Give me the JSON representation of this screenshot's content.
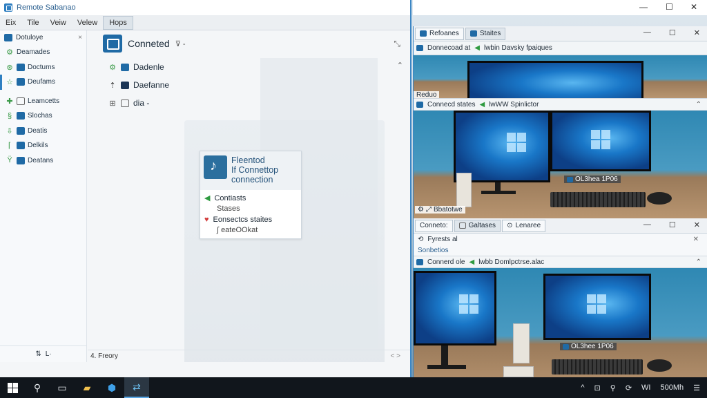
{
  "left_window": {
    "title": "Remote Sabanao",
    "menu": [
      "Eix",
      "Tile",
      "Veiw",
      "Velew",
      "Hops"
    ],
    "sidebar": {
      "header": "Dotuloye",
      "close": "×",
      "items": [
        {
          "icon": "gear-icon",
          "label": "Deamades"
        },
        {
          "icon": "network-icon",
          "label": "Doctums"
        },
        {
          "icon": "star-icon",
          "label": "Deufams"
        },
        {
          "icon": "arrow-icon",
          "label": "Leamcetts"
        },
        {
          "icon": "connector-icon",
          "label": "Slochas"
        },
        {
          "icon": "pin-icon",
          "label": "Deatis"
        },
        {
          "icon": "brace-icon",
          "label": "Delkils"
        },
        {
          "icon": "branch-icon",
          "label": "Deatans"
        }
      ],
      "footer_icon": "⇅",
      "footer_label": "L·"
    },
    "main": {
      "heading": "Conneted",
      "heading_suffix": "⊽ -",
      "tree": [
        {
          "label": "Dadenle"
        },
        {
          "label": "Daefanne"
        },
        {
          "label": "dia -"
        }
      ],
      "card": {
        "title": "Fleentod\nIf Connettop\nconnection",
        "rows": [
          {
            "icon": "arrow-icon",
            "label": "Contiasts"
          },
          {
            "icon": "",
            "label": "Stases"
          },
          {
            "icon": "heart-icon",
            "label": "Eonsectcs staites"
          },
          {
            "icon": "",
            "label": "∫ eateOOkat"
          }
        ]
      },
      "status": "4. Freory",
      "status_nav": "<  >"
    }
  },
  "right_window": {
    "controls": [
      "—",
      "☐",
      "✕"
    ],
    "top_tabs": [
      "Refoanes",
      "Staites"
    ],
    "top_controls": [
      "—",
      "☐",
      "✕"
    ],
    "pane1_bar": {
      "text": "Donnecoad at",
      "extra": "lwbin Davsky fpaiques"
    },
    "pane1_overlay": "Reduo",
    "pane2_bar": {
      "text": "Connecd states",
      "extra": "lwWW Spinlictor"
    },
    "pane2_overlay_left": "Bbatotwe",
    "pane2_overlay_right": "OL3hea 1P06",
    "mid_tabs": [
      "Conneto:",
      "Galtases",
      "Lenaree"
    ],
    "row_a": "Fyrests al",
    "row_b": "Sonbetios",
    "pane3_bar": {
      "text": "Connerd ole",
      "extra": "lwbb Domlpctrse.alac"
    },
    "pane3_overlay": "OL3hee 1P06"
  },
  "taskbar": {
    "icons": [
      "start-icon",
      "search-icon",
      "task-view-icon",
      "explorer-icon",
      "store-icon",
      "remote-desktop-icon"
    ],
    "tray": [
      "^",
      "⊡",
      "⚲",
      "⟳",
      "WI",
      "500Mh",
      "☰"
    ]
  }
}
